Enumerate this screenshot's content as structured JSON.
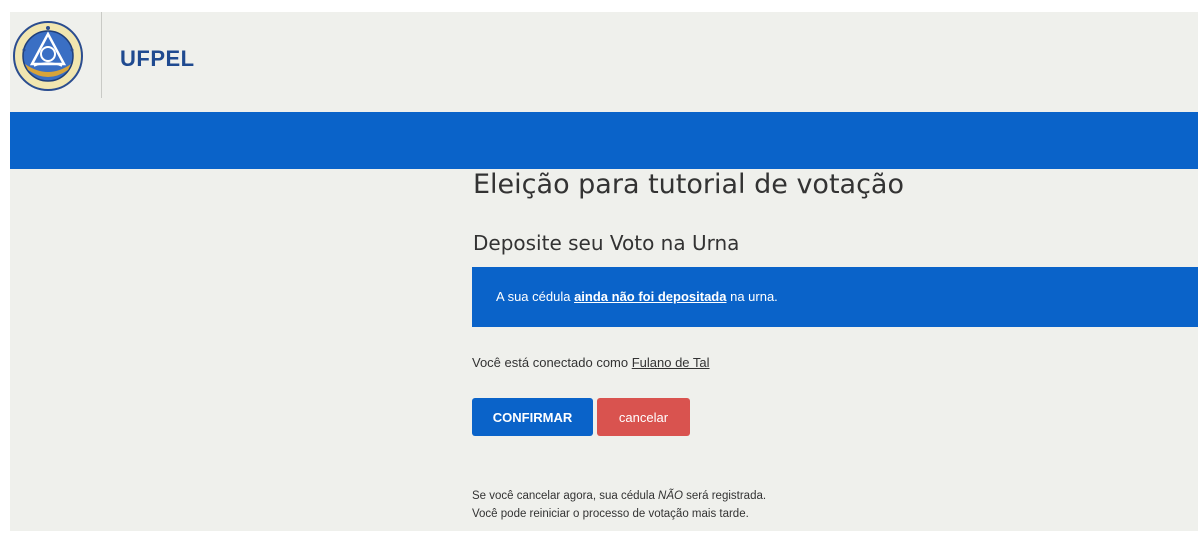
{
  "header": {
    "brand": "UFPEL",
    "logo_icon": "ufpel-seal-icon",
    "logo_text": "UNIVERSIDADE FEDERAL DE PELOTAS RS BRASIL"
  },
  "main": {
    "election_title": "Eleição para tutorial de votação",
    "subtitle": "Deposite seu Voto na Urna",
    "alert": {
      "prefix": "A sua cédula ",
      "link": "ainda não foi depositada",
      "suffix": " na urna."
    },
    "connected": {
      "prefix": "Você está conectado como ",
      "user": "Fulano de Tal"
    },
    "buttons": {
      "confirm": "CONFIRMAR",
      "cancel": "cancelar"
    },
    "note": {
      "line1_prefix": "Se você cancelar agora, sua cédula ",
      "line1_emphasis": "NÃO",
      "line1_suffix": " será registrada.",
      "line2": "Você pode reiniciar o processo de votação mais tarde."
    }
  },
  "colors": {
    "primary_blue": "#0a63c9",
    "cancel_red": "#d9534f",
    "brand_text": "#1f4a90",
    "page_background": "#eff0ec"
  }
}
